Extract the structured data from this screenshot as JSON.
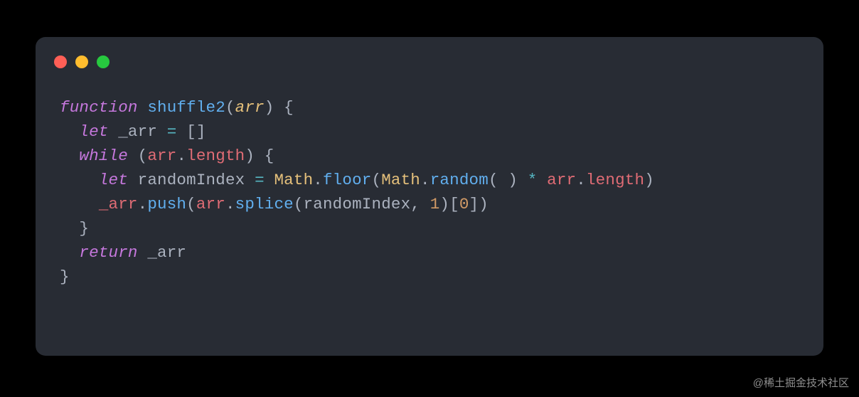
{
  "watermark": "@稀土掘金技术社区",
  "theme": {
    "background": "#282c34",
    "keyword": "#c678dd",
    "function": "#61afef",
    "variable": "#e5c07b",
    "property": "#e06c75",
    "number": "#d19a66",
    "operator": "#56b6c2",
    "punctuation": "#abb2bf"
  },
  "code": {
    "language": "javascript",
    "tokens": {
      "kw_function": "function",
      "fn_name": "shuffle2",
      "param_arr": "arr",
      "kw_let1": "let",
      "var__arr": "_arr",
      "kw_while": "while",
      "prop_length1": "length",
      "kw_let2": "let",
      "var_randomIndex": "randomIndex",
      "cls_Math1": "Math",
      "call_floor": "floor",
      "cls_Math2": "Math",
      "call_random": "random",
      "prop_length2": "length",
      "call_push": "push",
      "call_splice": "splice",
      "num_1": "1",
      "num_0": "0",
      "kw_return": "return",
      "p_open_paren1": "(",
      "p_close_paren1": ")",
      "p_space": " ",
      "p_open_brace1": "{",
      "p_assign": "=",
      "p_open_bracket": "[",
      "p_close_bracket": "]",
      "p_open_paren2": "(",
      "p_dot": ".",
      "p_close_paren2": ")",
      "p_open_brace2": "{",
      "p_open_paren3": "(",
      "p_close_paren3": ")",
      "p_star": "*",
      "p_comma": ",",
      "p_close_brace2": "}",
      "p_close_brace1": "}"
    }
  }
}
